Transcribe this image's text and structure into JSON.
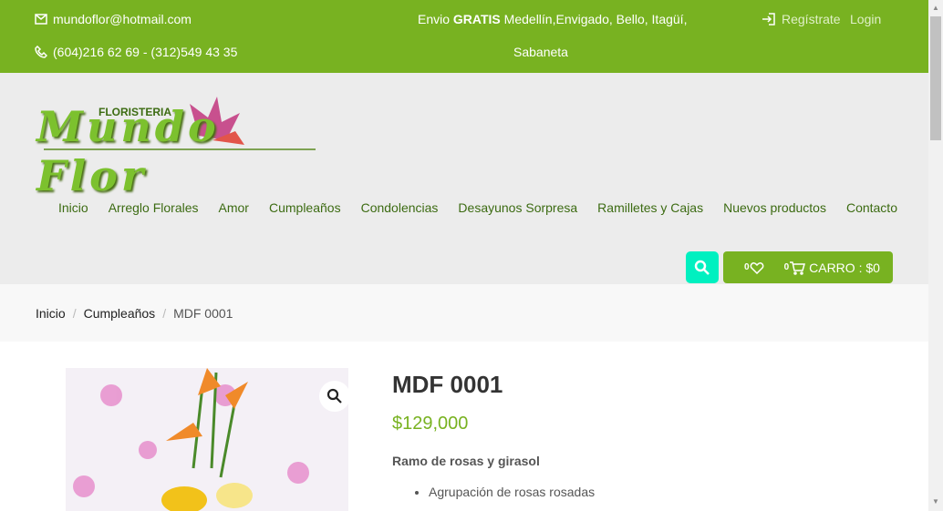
{
  "topbar": {
    "email": "mundoflor@hotmail.com",
    "phone": "(604)216 62 69 - (312)549 43 35",
    "shipping_prefix": "Envio ",
    "shipping_bold": "GRATIS",
    "shipping_rest": " Medellín,Envigado, Bello, Itagüí,",
    "shipping_line2": "Sabaneta",
    "register": "Regístrate",
    "login": "Login"
  },
  "logo": {
    "small": "FLORISTERIA",
    "main": "Mundo Flor"
  },
  "nav": [
    "Inicio",
    "Arreglo Florales",
    "Amor",
    "Cumpleaños",
    "Condolencias",
    "Desayunos Sorpresa",
    "Ramilletes y Cajas",
    "Nuevos productos",
    "Contacto"
  ],
  "cart": {
    "wishlist_count": "0",
    "cart_count": "0",
    "label": "CARRO : $0"
  },
  "breadcrumb": [
    "Inicio",
    "Cumpleaños",
    "MDF 0001"
  ],
  "product": {
    "title": "MDF 0001",
    "price": "$129,000",
    "description": "Ramo de rosas y girasol",
    "features": [
      "Agrupación de rosas rosadas"
    ]
  },
  "colors": {
    "brand": "#78b221",
    "search": "#00f0c0"
  }
}
